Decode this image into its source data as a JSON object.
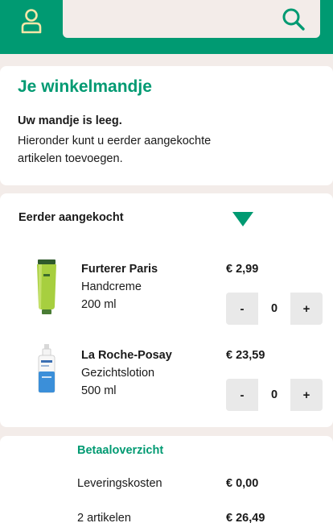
{
  "header": {
    "search_placeholder": "",
    "icons": {
      "account": "user-icon",
      "search": "search-icon"
    },
    "colors": {
      "brand": "#009a72",
      "accent_icon": "#f5e6a8",
      "background": "#f3ece9"
    }
  },
  "cart": {
    "title": "Je winkelmandje",
    "empty_title": "Uw mandje is leeg.",
    "empty_description": "Hieronder kunt u eerder aangekochte artikelen toevoegen."
  },
  "previously": {
    "title": "Eerder aangekocht",
    "expanded": true,
    "items": [
      {
        "brand": "Furterer Paris",
        "name": "Handcreme",
        "size": "200 ml",
        "price": "€ 2,99",
        "minus": "-",
        "quantity": "0",
        "plus": "+"
      },
      {
        "brand": "La Roche-Posay",
        "name": "Gezichtslotion",
        "size": "500 ml",
        "price": "€ 23,59",
        "minus": "-",
        "quantity": "0",
        "plus": "+"
      }
    ]
  },
  "payment": {
    "title": "Betaaloverzicht",
    "rows": [
      {
        "label": "Leveringskosten",
        "value": "€ 0,00"
      },
      {
        "label": "2 artikelen",
        "value": "€ 26,49"
      }
    ]
  }
}
